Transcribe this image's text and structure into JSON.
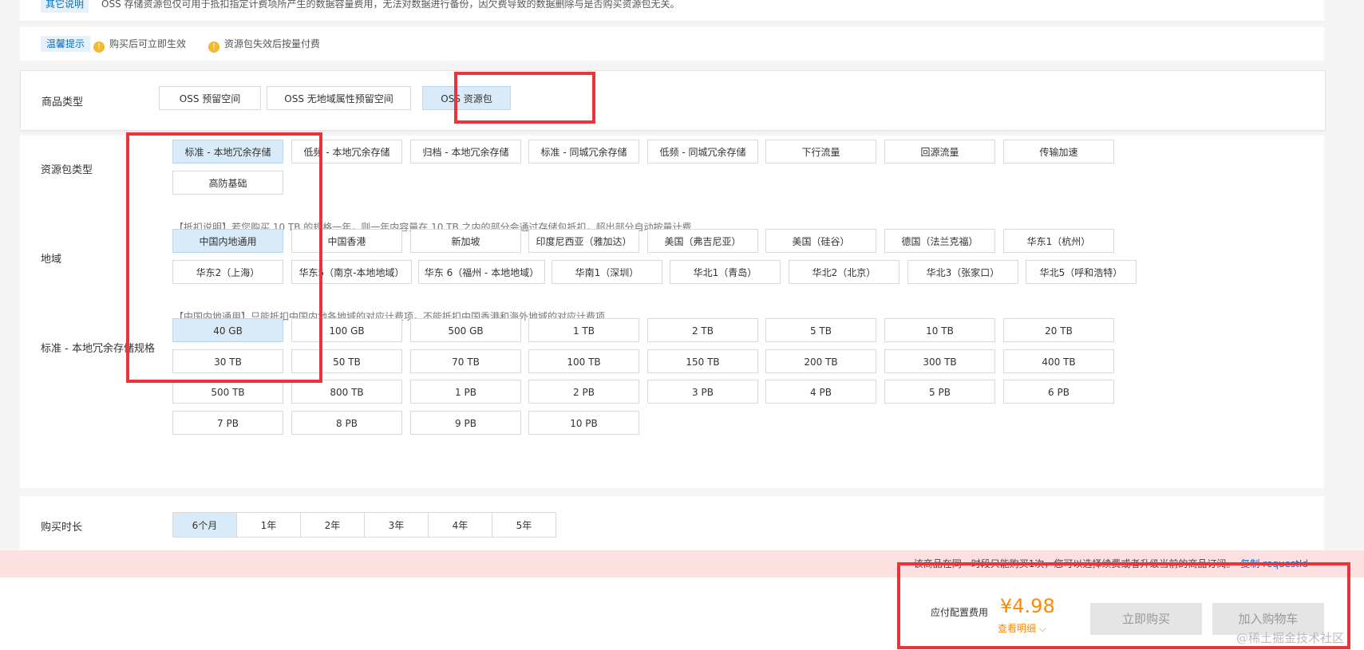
{
  "top_note": {
    "tag": "其它说明",
    "text": "OSS 存储资源包仅可用于抵扣指定计费项所产生的数据容量费用，无法对数据进行备份，因欠费导致的数据删除与是否购买资源包无关。"
  },
  "tips": {
    "tag": "温馨提示",
    "items": [
      "购买后可立即生效",
      "资源包失效后按量付费"
    ]
  },
  "product_type": {
    "label": "商品类型",
    "options": [
      "OSS 预留空间",
      "OSS 无地域属性预留空间",
      "OSS 资源包"
    ],
    "selected": "OSS 资源包"
  },
  "package_type": {
    "label": "资源包类型",
    "options": [
      "标准 - 本地冗余存储",
      "低频 - 本地冗余存储",
      "归档 - 本地冗余存储",
      "标准 - 同城冗余存储",
      "低频 - 同城冗余存储",
      "下行流量",
      "回源流量",
      "传输加速",
      "高防基础"
    ],
    "selected": "标准 - 本地冗余存储",
    "hint": "【抵扣说明】若您购买 10 TB 的规格一年，则一年内容量在 10 TB 之内的部分会通过存储包抵扣，超出部分自动按量计费"
  },
  "region": {
    "label": "地域",
    "options": [
      "中国内地通用",
      "中国香港",
      "新加坡",
      "印度尼西亚（雅加达）",
      "美国（弗吉尼亚）",
      "美国（硅谷）",
      "德国（法兰克福）",
      "华东1（杭州）",
      "华东2（上海）",
      "华东5（南京-本地地域）",
      "华东 6（福州 - 本地地域）",
      "华南1（深圳）",
      "华北1（青岛）",
      "华北2（北京）",
      "华北3（张家口）",
      "华北5（呼和浩特）"
    ],
    "selected": "中国内地通用",
    "hint": "【中国内地通用】只能抵扣中国内地各地域的对应计费项，不能抵扣中国香港和海外地域的对应计费项"
  },
  "spec": {
    "label": "标准 - 本地冗余存储规格",
    "options": [
      "40 GB",
      "100 GB",
      "500 GB",
      "1 TB",
      "2 TB",
      "5 TB",
      "10 TB",
      "20 TB",
      "30 TB",
      "50 TB",
      "70 TB",
      "100 TB",
      "150 TB",
      "200 TB",
      "300 TB",
      "400 TB",
      "500 TB",
      "800 TB",
      "1 PB",
      "2 PB",
      "3 PB",
      "4 PB",
      "5 PB",
      "6 PB",
      "7 PB",
      "8 PB",
      "9 PB",
      "10 PB"
    ],
    "selected": "40 GB"
  },
  "duration": {
    "label": "购买时长",
    "options": [
      "6个月",
      "1年",
      "2年",
      "3年",
      "4年",
      "5年"
    ],
    "selected": "6个月"
  },
  "alert": {
    "text": "该商品在同一时段只能购买1次，您可以选择续费或者升级当前的商品订阅。",
    "link": "复制 requestId"
  },
  "footer": {
    "fee_label": "应付配置费用",
    "price": "¥4.98",
    "detail_link": "查看明细",
    "buy_button": "立即购买",
    "cart_button": "加入购物车"
  },
  "watermark": "@稀土掘金技术社区",
  "colors": {
    "accent": "#0070cc",
    "selected_bg": "#d9ebf8",
    "price": "#ff8a00",
    "highlight": "#e8343a",
    "alert_bg": "#fde1e1"
  }
}
